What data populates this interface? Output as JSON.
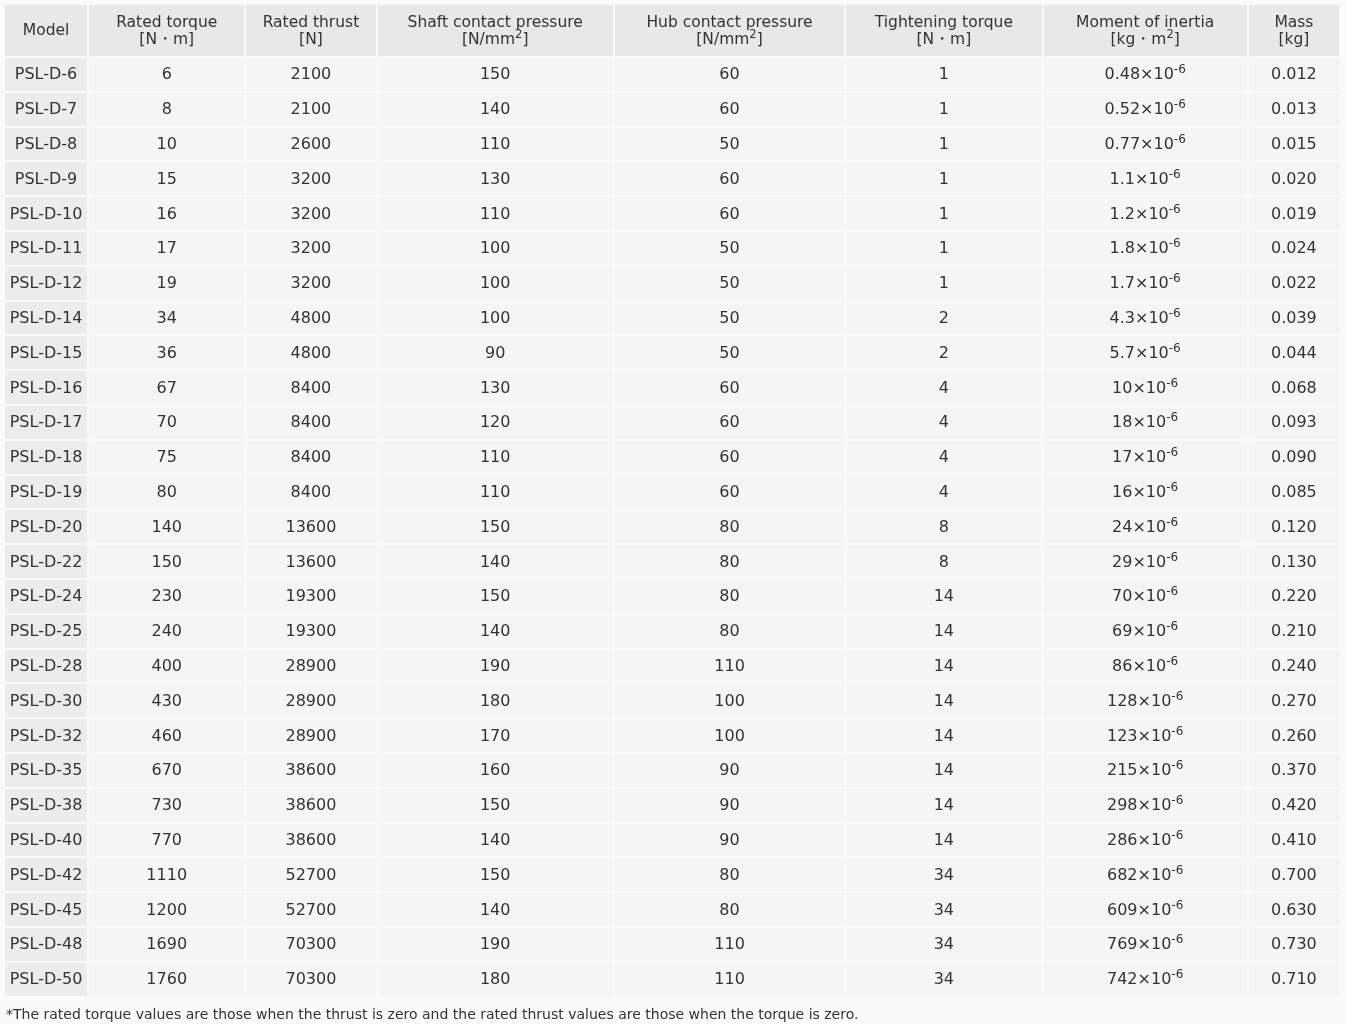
{
  "table": {
    "columns": [
      {
        "lines": [
          "Model"
        ]
      },
      {
        "lines": [
          "Rated torque",
          "[N・m]"
        ]
      },
      {
        "lines": [
          "Rated thrust",
          "[N]"
        ]
      },
      {
        "lines": [
          "Shaft contact pressure",
          "[N/mm$^{2}$]"
        ]
      },
      {
        "lines": [
          "Hub contact pressure",
          "[N/mm$^{2}$]"
        ]
      },
      {
        "lines": [
          "Tightening torque",
          "[N・m]"
        ]
      },
      {
        "lines": [
          "Moment of inertia",
          "[kg・m$^{2}$]"
        ]
      },
      {
        "lines": [
          "Mass",
          "[kg]"
        ]
      }
    ],
    "rows": [
      [
        "PSL-D-6",
        "6",
        "2100",
        "150",
        "60",
        "1",
        "0.48×10$^{-6}$",
        "0.012"
      ],
      [
        "PSL-D-7",
        "8",
        "2100",
        "140",
        "60",
        "1",
        "0.52×10$^{-6}$",
        "0.013"
      ],
      [
        "PSL-D-8",
        "10",
        "2600",
        "110",
        "50",
        "1",
        "0.77×10$^{-6}$",
        "0.015"
      ],
      [
        "PSL-D-9",
        "15",
        "3200",
        "130",
        "60",
        "1",
        "1.1×10$^{-6}$",
        "0.020"
      ],
      [
        "PSL-D-10",
        "16",
        "3200",
        "110",
        "60",
        "1",
        "1.2×10$^{-6}$",
        "0.019"
      ],
      [
        "PSL-D-11",
        "17",
        "3200",
        "100",
        "50",
        "1",
        "1.8×10$^{-6}$",
        "0.024"
      ],
      [
        "PSL-D-12",
        "19",
        "3200",
        "100",
        "50",
        "1",
        "1.7×10$^{-6}$",
        "0.022"
      ],
      [
        "PSL-D-14",
        "34",
        "4800",
        "100",
        "50",
        "2",
        "4.3×10$^{-6}$",
        "0.039"
      ],
      [
        "PSL-D-15",
        "36",
        "4800",
        "90",
        "50",
        "2",
        "5.7×10$^{-6}$",
        "0.044"
      ],
      [
        "PSL-D-16",
        "67",
        "8400",
        "130",
        "60",
        "4",
        "10×10$^{-6}$",
        "0.068"
      ],
      [
        "PSL-D-17",
        "70",
        "8400",
        "120",
        "60",
        "4",
        "18×10$^{-6}$",
        "0.093"
      ],
      [
        "PSL-D-18",
        "75",
        "8400",
        "110",
        "60",
        "4",
        "17×10$^{-6}$",
        "0.090"
      ],
      [
        "PSL-D-19",
        "80",
        "8400",
        "110",
        "60",
        "4",
        "16×10$^{-6}$",
        "0.085"
      ],
      [
        "PSL-D-20",
        "140",
        "13600",
        "150",
        "80",
        "8",
        "24×10$^{-6}$",
        "0.120"
      ],
      [
        "PSL-D-22",
        "150",
        "13600",
        "140",
        "80",
        "8",
        "29×10$^{-6}$",
        "0.130"
      ],
      [
        "PSL-D-24",
        "230",
        "19300",
        "150",
        "80",
        "14",
        "70×10$^{-6}$",
        "0.220"
      ],
      [
        "PSL-D-25",
        "240",
        "19300",
        "140",
        "80",
        "14",
        "69×10$^{-6}$",
        "0.210"
      ],
      [
        "PSL-D-28",
        "400",
        "28900",
        "190",
        "110",
        "14",
        "86×10$^{-6}$",
        "0.240"
      ],
      [
        "PSL-D-30",
        "430",
        "28900",
        "180",
        "100",
        "14",
        "128×10$^{-6}$",
        "0.270"
      ],
      [
        "PSL-D-32",
        "460",
        "28900",
        "170",
        "100",
        "14",
        "123×10$^{-6}$",
        "0.260"
      ],
      [
        "PSL-D-35",
        "670",
        "38600",
        "160",
        "90",
        "14",
        "215×10$^{-6}$",
        "0.370"
      ],
      [
        "PSL-D-38",
        "730",
        "38600",
        "150",
        "90",
        "14",
        "298×10$^{-6}$",
        "0.420"
      ],
      [
        "PSL-D-40",
        "770",
        "38600",
        "140",
        "90",
        "14",
        "286×10$^{-6}$",
        "0.410"
      ],
      [
        "PSL-D-42",
        "1110",
        "52700",
        "150",
        "80",
        "34",
        "682×10$^{-6}$",
        "0.700"
      ],
      [
        "PSL-D-45",
        "1200",
        "52700",
        "140",
        "80",
        "34",
        "609×10$^{-6}$",
        "0.630"
      ],
      [
        "PSL-D-48",
        "1690",
        "70300",
        "190",
        "110",
        "34",
        "769×10$^{-6}$",
        "0.730"
      ],
      [
        "PSL-D-50",
        "1760",
        "70300",
        "180",
        "110",
        "34",
        "742×10$^{-6}$",
        "0.710"
      ]
    ]
  },
  "footnote": "*The rated torque values are those when the thrust is zero and the rated thrust values are those when the torque is zero."
}
